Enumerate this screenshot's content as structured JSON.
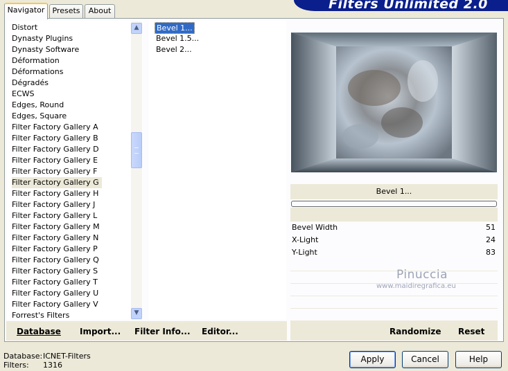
{
  "app": {
    "title_banner": "Filters Unlimited 2.0"
  },
  "tabs": [
    {
      "label": "Navigator",
      "active": true
    },
    {
      "label": "Presets",
      "active": false
    },
    {
      "label": "About",
      "active": false
    }
  ],
  "categories": [
    {
      "label": "Distort"
    },
    {
      "label": "Dynasty Plugins"
    },
    {
      "label": "Dynasty Software"
    },
    {
      "label": "Déformation"
    },
    {
      "label": "Déformations"
    },
    {
      "label": "Dégradés"
    },
    {
      "label": "ECWS"
    },
    {
      "label": "Edges, Round"
    },
    {
      "label": "Edges, Square"
    },
    {
      "label": "Filter Factory Gallery A"
    },
    {
      "label": "Filter Factory Gallery B"
    },
    {
      "label": "Filter Factory Gallery D"
    },
    {
      "label": "Filter Factory Gallery E"
    },
    {
      "label": "Filter Factory Gallery F"
    },
    {
      "label": "Filter Factory Gallery G",
      "selected": true
    },
    {
      "label": "Filter Factory Gallery H"
    },
    {
      "label": "Filter Factory Gallery J"
    },
    {
      "label": "Filter Factory Gallery L"
    },
    {
      "label": "Filter Factory Gallery M"
    },
    {
      "label": "Filter Factory Gallery N"
    },
    {
      "label": "Filter Factory Gallery P"
    },
    {
      "label": "Filter Factory Gallery Q"
    },
    {
      "label": "Filter Factory Gallery S"
    },
    {
      "label": "Filter Factory Gallery T"
    },
    {
      "label": "Filter Factory Gallery U"
    },
    {
      "label": "Filter Factory Gallery V"
    },
    {
      "label": "Forrest's Filters"
    }
  ],
  "filters": [
    {
      "label": "Bevel 1...",
      "selected": true
    },
    {
      "label": "Bevel 1.5..."
    },
    {
      "label": "Bevel 2..."
    }
  ],
  "preview": {
    "filter_name": "Bevel 1..."
  },
  "sliders": [
    {
      "label": "Bevel Width",
      "value": "51"
    },
    {
      "label": "X-Light",
      "value": "24"
    },
    {
      "label": "Y-Light",
      "value": "83"
    }
  ],
  "watermark": {
    "name": "Pinuccia",
    "url": "www.maidiregrafica.eu"
  },
  "left_buttons": {
    "database": "Database",
    "import": "Import...",
    "filter_info": "Filter Info...",
    "editor": "Editor..."
  },
  "right_buttons": {
    "randomize": "Randomize",
    "reset": "Reset"
  },
  "status": {
    "database_label": "Database:",
    "database_value": "ICNET-Filters",
    "filters_label": "Filters:",
    "filters_value": "1316"
  },
  "dialog_buttons": {
    "apply": "Apply",
    "cancel": "Cancel",
    "help": "Help"
  },
  "icons": {
    "scroll_up": "chevron-up-icon",
    "scroll_down": "chevron-down-icon",
    "scroll_grip": "grip-icon"
  }
}
